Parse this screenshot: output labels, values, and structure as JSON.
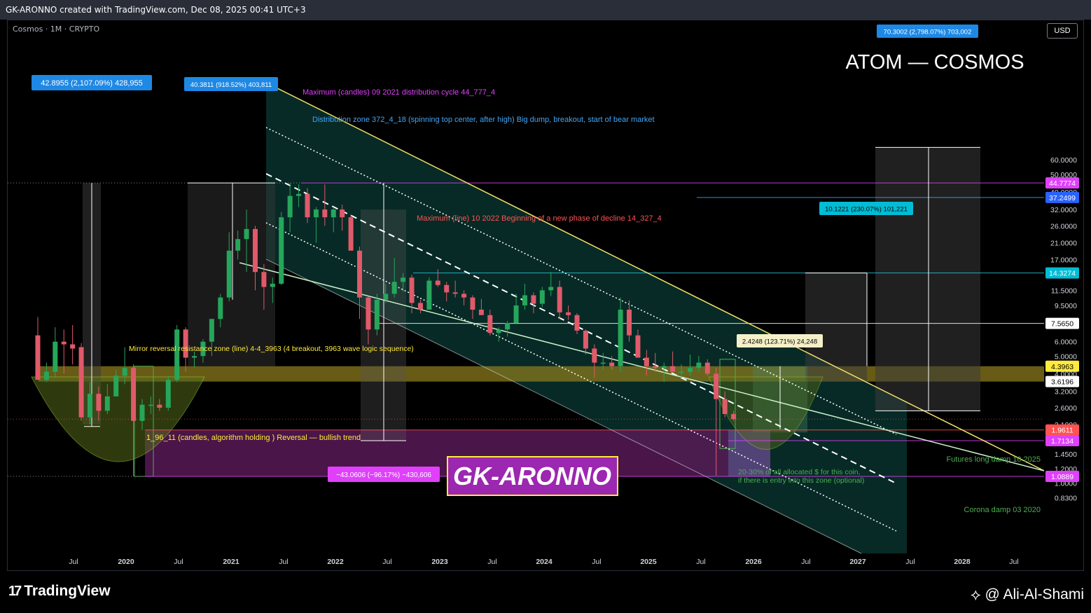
{
  "header": {
    "text": "GK-ARONNO created with TradingView.com, Dec 08, 2025 00:41 UTC+3"
  },
  "symbol": {
    "label": "Cosmos · 1M · CRYPTO",
    "currency": "USD"
  },
  "title": "ATOM — COSMOS",
  "watermark": "GK-ARONNO",
  "footer": {
    "brand": "TradingView",
    "author": "@ Ali-Al-Shami"
  },
  "colors": {
    "up": "#26a65b",
    "down": "#e05a6a",
    "channel_fill": "#0d4d45",
    "resistance": "#f2e06b",
    "zone_fill": "#8a7a1e",
    "purple_zone": "#5c1a5a"
  },
  "chart_data": {
    "type": "candlestick",
    "title": "ATOM — COSMOS",
    "y_scale": "log",
    "y_ticks": [
      60.0,
      50.0,
      40.0,
      32.0,
      26.0,
      21.0,
      17.0,
      14.0,
      11.5,
      9.5,
      7.5,
      6.0,
      5.0,
      4.0,
      3.2,
      2.6,
      2.1,
      1.7,
      1.45,
      1.2,
      1.0,
      0.83
    ],
    "x_ticks": [
      "Jul",
      "2020",
      "Jul",
      "2021",
      "Jul",
      "2022",
      "Jul",
      "2023",
      "Jul",
      "2024",
      "Jul",
      "2025",
      "Jul",
      "2026",
      "Jul",
      "2027",
      "Jul",
      "2028",
      "Jul"
    ],
    "candles": [
      {
        "date": "2019-04",
        "o": 6.5,
        "h": 8.2,
        "l": 3.7,
        "c": 3.7
      },
      {
        "date": "2019-05",
        "o": 3.7,
        "h": 4.6,
        "l": 3.6,
        "c": 4.1
      },
      {
        "date": "2019-06",
        "o": 4.1,
        "h": 7.2,
        "l": 3.8,
        "c": 6.0
      },
      {
        "date": "2019-07",
        "o": 6.0,
        "h": 7.0,
        "l": 4.0,
        "c": 5.8
      },
      {
        "date": "2019-08",
        "o": 5.8,
        "h": 7.4,
        "l": 4.5,
        "c": 5.5
      },
      {
        "date": "2019-09",
        "o": 5.6,
        "h": 5.9,
        "l": 2.2,
        "c": 2.3
      },
      {
        "date": "2019-10",
        "o": 2.3,
        "h": 3.6,
        "l": 2.1,
        "c": 3.1
      },
      {
        "date": "2019-11",
        "o": 3.1,
        "h": 3.4,
        "l": 2.2,
        "c": 2.5
      },
      {
        "date": "2019-12",
        "o": 2.5,
        "h": 3.5,
        "l": 2.4,
        "c": 3.0
      },
      {
        "date": "2020-01",
        "o": 3.0,
        "h": 4.2,
        "l": 3.0,
        "c": 3.9
      },
      {
        "date": "2020-02",
        "o": 3.9,
        "h": 5.6,
        "l": 3.5,
        "c": 4.3
      },
      {
        "date": "2020-03",
        "o": 4.3,
        "h": 4.5,
        "l": 1.09,
        "c": 2.2
      },
      {
        "date": "2020-04",
        "o": 2.2,
        "h": 2.9,
        "l": 1.96,
        "c": 2.7
      },
      {
        "date": "2020-05",
        "o": 2.7,
        "h": 3.0,
        "l": 2.4,
        "c": 2.7
      },
      {
        "date": "2020-06",
        "o": 2.7,
        "h": 2.9,
        "l": 2.5,
        "c": 2.6
      },
      {
        "date": "2020-07",
        "o": 2.6,
        "h": 3.9,
        "l": 2.5,
        "c": 3.7
      },
      {
        "date": "2020-08",
        "o": 3.7,
        "h": 7.4,
        "l": 3.6,
        "c": 7.0
      },
      {
        "date": "2020-09",
        "o": 7.0,
        "h": 7.2,
        "l": 4.1,
        "c": 4.9
      },
      {
        "date": "2020-10",
        "o": 4.9,
        "h": 5.3,
        "l": 4.3,
        "c": 5.0
      },
      {
        "date": "2020-11",
        "o": 5.0,
        "h": 6.2,
        "l": 4.6,
        "c": 6.0
      },
      {
        "date": "2020-12",
        "o": 6.0,
        "h": 8.0,
        "l": 5.0,
        "c": 8.0
      },
      {
        "date": "2021-01",
        "o": 8.0,
        "h": 11.0,
        "l": 7.2,
        "c": 10.5
      },
      {
        "date": "2021-02",
        "o": 10.5,
        "h": 24.0,
        "l": 10.0,
        "c": 19.0
      },
      {
        "date": "2021-03",
        "o": 19.0,
        "h": 24.5,
        "l": 17.0,
        "c": 22.0
      },
      {
        "date": "2021-04",
        "o": 22.0,
        "h": 32.0,
        "l": 14.5,
        "c": 25.0
      },
      {
        "date": "2021-05",
        "o": 25.0,
        "h": 26.0,
        "l": 11.5,
        "c": 14.5
      },
      {
        "date": "2021-06",
        "o": 14.5,
        "h": 16.0,
        "l": 9.0,
        "c": 12.0
      },
      {
        "date": "2021-07",
        "o": 12.0,
        "h": 13.5,
        "l": 9.8,
        "c": 12.5
      },
      {
        "date": "2021-08",
        "o": 12.5,
        "h": 31.0,
        "l": 12.3,
        "c": 29.0
      },
      {
        "date": "2021-09",
        "o": 29.0,
        "h": 44.8,
        "l": 24.0,
        "c": 38.0
      },
      {
        "date": "2021-10",
        "o": 38.0,
        "h": 44.0,
        "l": 33.0,
        "c": 39.0
      },
      {
        "date": "2021-11",
        "o": 39.0,
        "h": 42.0,
        "l": 27.0,
        "c": 29.0
      },
      {
        "date": "2021-12",
        "o": 29.0,
        "h": 33.0,
        "l": 21.0,
        "c": 32.0
      },
      {
        "date": "2022-01",
        "o": 32.0,
        "h": 44.0,
        "l": 26.0,
        "c": 29.0
      },
      {
        "date": "2022-02",
        "o": 29.0,
        "h": 33.0,
        "l": 24.0,
        "c": 32.0
      },
      {
        "date": "2022-03",
        "o": 32.0,
        "h": 34.0,
        "l": 24.5,
        "c": 29.0
      },
      {
        "date": "2022-04",
        "o": 29.0,
        "h": 30.0,
        "l": 20.0,
        "c": 19.0
      },
      {
        "date": "2022-05",
        "o": 19.0,
        "h": 20.0,
        "l": 8.0,
        "c": 10.5
      },
      {
        "date": "2022-06",
        "o": 10.5,
        "h": 10.6,
        "l": 5.8,
        "c": 7.0
      },
      {
        "date": "2022-07",
        "o": 7.0,
        "h": 11.0,
        "l": 6.5,
        "c": 10.2
      },
      {
        "date": "2022-08",
        "o": 10.2,
        "h": 12.5,
        "l": 9.8,
        "c": 11.0
      },
      {
        "date": "2022-09",
        "o": 11.0,
        "h": 17.3,
        "l": 10.5,
        "c": 12.8
      },
      {
        "date": "2022-10",
        "o": 12.8,
        "h": 14.3,
        "l": 11.3,
        "c": 13.5
      },
      {
        "date": "2022-11",
        "o": 13.5,
        "h": 14.0,
        "l": 8.6,
        "c": 9.8
      },
      {
        "date": "2022-12",
        "o": 9.8,
        "h": 10.2,
        "l": 8.6,
        "c": 9.0
      },
      {
        "date": "2023-01",
        "o": 9.0,
        "h": 13.5,
        "l": 9.0,
        "c": 13.0
      },
      {
        "date": "2023-02",
        "o": 13.0,
        "h": 15.0,
        "l": 12.0,
        "c": 12.3
      },
      {
        "date": "2023-03",
        "o": 12.3,
        "h": 12.8,
        "l": 10.0,
        "c": 11.2
      },
      {
        "date": "2023-04",
        "o": 11.2,
        "h": 13.0,
        "l": 10.5,
        "c": 11.0
      },
      {
        "date": "2023-05",
        "o": 11.0,
        "h": 11.5,
        "l": 9.5,
        "c": 10.5
      },
      {
        "date": "2023-06",
        "o": 10.5,
        "h": 10.8,
        "l": 8.0,
        "c": 9.0
      },
      {
        "date": "2023-07",
        "o": 9.0,
        "h": 10.3,
        "l": 8.5,
        "c": 8.4
      },
      {
        "date": "2023-08",
        "o": 8.4,
        "h": 9.0,
        "l": 6.5,
        "c": 6.7
      },
      {
        "date": "2023-09",
        "o": 6.7,
        "h": 7.2,
        "l": 6.0,
        "c": 7.0
      },
      {
        "date": "2023-10",
        "o": 7.0,
        "h": 7.8,
        "l": 6.4,
        "c": 7.6
      },
      {
        "date": "2023-11",
        "o": 7.6,
        "h": 11.0,
        "l": 7.5,
        "c": 9.5
      },
      {
        "date": "2023-12",
        "o": 9.5,
        "h": 12.5,
        "l": 9.0,
        "c": 10.8
      },
      {
        "date": "2024-01",
        "o": 10.8,
        "h": 11.2,
        "l": 8.6,
        "c": 9.7
      },
      {
        "date": "2024-02",
        "o": 9.7,
        "h": 12.0,
        "l": 9.3,
        "c": 11.5
      },
      {
        "date": "2024-03",
        "o": 11.5,
        "h": 14.5,
        "l": 10.7,
        "c": 12.0
      },
      {
        "date": "2024-04",
        "o": 12.0,
        "h": 13.0,
        "l": 8.0,
        "c": 8.7
      },
      {
        "date": "2024-05",
        "o": 8.7,
        "h": 9.5,
        "l": 7.9,
        "c": 8.4
      },
      {
        "date": "2024-06",
        "o": 8.4,
        "h": 8.6,
        "l": 6.6,
        "c": 6.9
      },
      {
        "date": "2024-07",
        "o": 6.9,
        "h": 7.0,
        "l": 5.1,
        "c": 5.5
      },
      {
        "date": "2024-08",
        "o": 5.5,
        "h": 5.8,
        "l": 3.8,
        "c": 4.6
      },
      {
        "date": "2024-09",
        "o": 4.6,
        "h": 5.2,
        "l": 4.2,
        "c": 4.6
      },
      {
        "date": "2024-10",
        "o": 4.6,
        "h": 5.0,
        "l": 4.2,
        "c": 4.4
      },
      {
        "date": "2024-11",
        "o": 4.4,
        "h": 10.5,
        "l": 4.1,
        "c": 9.0
      },
      {
        "date": "2024-12",
        "o": 9.0,
        "h": 10.1,
        "l": 6.0,
        "c": 6.5
      },
      {
        "date": "2025-01",
        "o": 6.5,
        "h": 7.0,
        "l": 5.6,
        "c": 4.9
      },
      {
        "date": "2025-02",
        "o": 4.9,
        "h": 5.4,
        "l": 3.9,
        "c": 4.4
      },
      {
        "date": "2025-03",
        "o": 4.4,
        "h": 5.2,
        "l": 4.1,
        "c": 4.3
      },
      {
        "date": "2025-04",
        "o": 4.3,
        "h": 4.6,
        "l": 3.6,
        "c": 4.4
      },
      {
        "date": "2025-05",
        "o": 4.4,
        "h": 5.3,
        "l": 4.2,
        "c": 4.1
      },
      {
        "date": "2025-06",
        "o": 4.1,
        "h": 4.5,
        "l": 3.8,
        "c": 4.1
      },
      {
        "date": "2025-07",
        "o": 4.1,
        "h": 5.1,
        "l": 3.9,
        "c": 4.3
      },
      {
        "date": "2025-08",
        "o": 4.3,
        "h": 5.0,
        "l": 4.1,
        "c": 4.6
      },
      {
        "date": "2025-09",
        "o": 4.6,
        "h": 4.8,
        "l": 3.9,
        "c": 4.0
      },
      {
        "date": "2025-10",
        "o": 4.0,
        "h": 4.3,
        "l": 1.1,
        "c": 2.9
      },
      {
        "date": "2025-11",
        "o": 2.9,
        "h": 3.2,
        "l": 2.3,
        "c": 2.4
      },
      {
        "date": "2025-12",
        "o": 2.4,
        "h": 2.5,
        "l": 2.2,
        "c": 2.25
      }
    ],
    "price_labels": [
      {
        "value": 44.7774,
        "text": "44.7774",
        "color": "#e040fb"
      },
      {
        "value": 37.2499,
        "text": "37.2499",
        "color": "#2962ff"
      },
      {
        "value": 14.3274,
        "text": "14.3274",
        "color": "#00bcd4"
      },
      {
        "value": 7.565,
        "text": "7.5650",
        "color": "#ffffff"
      },
      {
        "value": 4.3963,
        "text": "4.3963",
        "color": "#ffeb3b"
      },
      {
        "value": 3.6196,
        "text": "3.6196",
        "color": "#ffffff"
      },
      {
        "value": 1.9611,
        "text": "1.9611",
        "color": "#ff5252"
      },
      {
        "value": 1.7134,
        "text": "1.7134",
        "color": "#e040fb"
      },
      {
        "value": 1.0889,
        "text": "1.0889",
        "color": "#e040fb"
      }
    ],
    "annotations": {
      "max_candles": "Maximum (candles) 09 2021 distribution cycle 44_777_4",
      "dist_zone": "Distribution zone 372_4_18 (spinning top center, after high) Big dump, breakout, start of bear market",
      "max_line": "Maximum (line) 10 2022 Beginning of a new phase of decline 14_327_4",
      "mirror_zone": "Mirror reversal resistance zone (line) 4-4_3963 (4 breakout, 3963 wave logic sequence)",
      "reversal": "1_96_11 (candles, algorithm holding ) Reversal — bullish trend",
      "futures": "Futures long damp 10 2025",
      "corona": "Corona damp 03 2020",
      "alloc_1": "20-30% of all allocated $ for this coin,",
      "alloc_2": "if there is entry into this zone (optional)"
    },
    "measure_labels": {
      "m1": "42.8955 (2,107.09%) 428,955",
      "m2": "40.3811 (918.52%) 403,811",
      "m3": "−43.0606 (−96.17%) −430,606",
      "m4": "10.1221 (230.07%) 101,221",
      "m5": "70.3002 (2,798.07%) 703,002",
      "m6": "2.4248 (123.71%) 24,248"
    }
  }
}
